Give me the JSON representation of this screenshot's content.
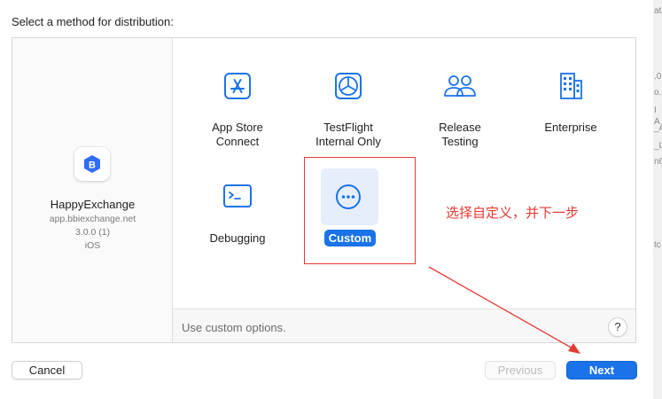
{
  "prompt": "Select a method for distribution:",
  "app": {
    "name": "HappyExchange",
    "bundle_id": "app.bbiexchange.net",
    "version": "3.0.0 (1)",
    "platform": "iOS",
    "icon_letter": "B"
  },
  "options": [
    {
      "label": "App Store\nConnect",
      "icon": "app-store-icon"
    },
    {
      "label": "TestFlight\nInternal Only",
      "icon": "testflight-icon"
    },
    {
      "label": "Release\nTesting",
      "icon": "users-icon"
    },
    {
      "label": "Enterprise",
      "icon": "building-icon"
    },
    {
      "label": "Debugging",
      "icon": "terminal-icon"
    },
    {
      "label": "Custom",
      "icon": "ellipsis-circle-icon",
      "selected": true
    }
  ],
  "description": "Use custom options.",
  "help_label": "?",
  "buttons": {
    "cancel": "Cancel",
    "previous": "Previous",
    "next": "Next"
  },
  "annotation": "选择自定义，并下一步",
  "colors": {
    "accent": "#1a73e8",
    "annotation": "#e53935"
  },
  "background_window_fragments": [
    "at",
    ".0",
    "o.b",
    "I A",
    "_A",
    "_L",
    "n6",
    "tc"
  ]
}
